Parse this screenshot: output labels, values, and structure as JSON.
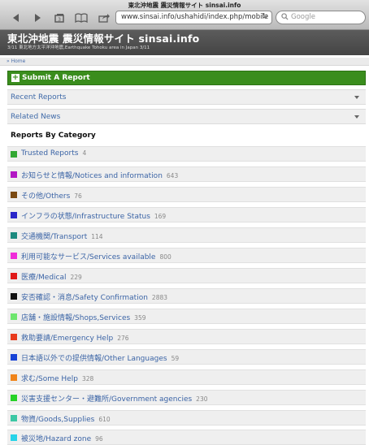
{
  "browser": {
    "tab_title": "東北沖地震 震災情報サイト sinsai.info",
    "url": "www.sinsai.info/ushahidi/index.php/mobile",
    "search_placeholder": "Google"
  },
  "site": {
    "title": "東北沖地震 震災情報サイト sinsai.info",
    "subtitle": "3/11 東北地方太平洋沖地震,Earthquake Tohoku area in Japan 3/11"
  },
  "breadcrumb": "» Home",
  "submit_label": "Submit A Report",
  "sections": [
    {
      "label": "Recent Reports"
    },
    {
      "label": "Related News"
    }
  ],
  "category_heading": "Reports By Category",
  "categories": [
    {
      "label": "Trusted Reports",
      "count": "4",
      "color": "#33a833"
    },
    {
      "label": "お知らせと情報/Notices and information",
      "count": "643",
      "color": "#b217c4"
    },
    {
      "label": "その他/Others",
      "count": "76",
      "color": "#7a4a12"
    },
    {
      "label": "インフラの状態/Infrastructure Status",
      "count": "169",
      "color": "#2a27c9"
    },
    {
      "label": "交通機関/Transport",
      "count": "114",
      "color": "#1d8a7f"
    },
    {
      "label": "利用可能なサービス/Services available",
      "count": "800",
      "color": "#f02bd9"
    },
    {
      "label": "医療/Medical",
      "count": "229",
      "color": "#e01818"
    },
    {
      "label": "安否確認・消息/Safety Confirmation",
      "count": "2883",
      "color": "#111111"
    },
    {
      "label": "店舗・施設情報/Shops,Services",
      "count": "359",
      "color": "#6ee66e"
    },
    {
      "label": "救助要請/Emergency Help",
      "count": "276",
      "color": "#e83a1c"
    },
    {
      "label": "日本語以外での提供情報/Other Languages",
      "count": "59",
      "color": "#1843d6"
    },
    {
      "label": "求む/Some Help",
      "count": "328",
      "color": "#f0841a"
    },
    {
      "label": "災害支援センター・避難所/Government agencies",
      "count": "230",
      "color": "#26d226"
    },
    {
      "label": "物資/Goods,Supplies",
      "count": "610",
      "color": "#3cc7a4"
    },
    {
      "label": "被災地/Hazard zone",
      "count": "96",
      "color": "#27d3e8"
    }
  ]
}
